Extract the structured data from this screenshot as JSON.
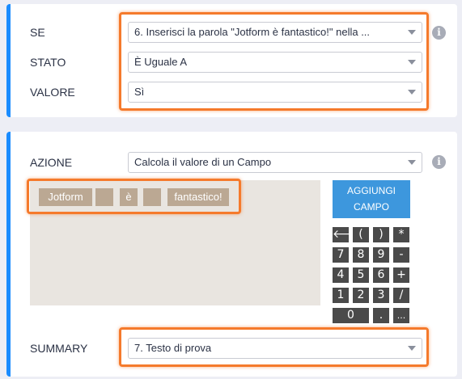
{
  "condition": {
    "if_label": "SE",
    "if_value": "6. Inserisci la parola \"Jotform è fantastico!\" nella ...",
    "state_label": "STATO",
    "state_value": "È Uguale A",
    "value_label": "VALORE",
    "value_value": "Sì",
    "info_icon": "i"
  },
  "action": {
    "action_label": "AZIONE",
    "action_value": "Calcola il valore di un Campo",
    "info_icon": "i",
    "tokens": [
      "Jotform",
      "",
      "è",
      "",
      "fantastico!"
    ],
    "add_field_line1": "AGGIUNGI",
    "add_field_line2": "CAMPO",
    "keypad": {
      "back": "🡐",
      "open_paren": "(",
      "close_paren": ")",
      "multiply": "*",
      "k7": "7",
      "k8": "8",
      "k9": "9",
      "minus": "-",
      "k4": "4",
      "k5": "5",
      "k6": "6",
      "plus": "+",
      "k1": "1",
      "k2": "2",
      "k3": "3",
      "divide": "/",
      "k0": "0",
      "dot": ".",
      "more": "..."
    },
    "summary_label": "SUMMARY",
    "summary_value": "7. Testo di prova"
  },
  "colors": {
    "accent": "#1a8cff",
    "highlight": "#f57a2c",
    "token": "#bba893",
    "add_button": "#3d97dd",
    "keypad": "#4a4a4a"
  }
}
